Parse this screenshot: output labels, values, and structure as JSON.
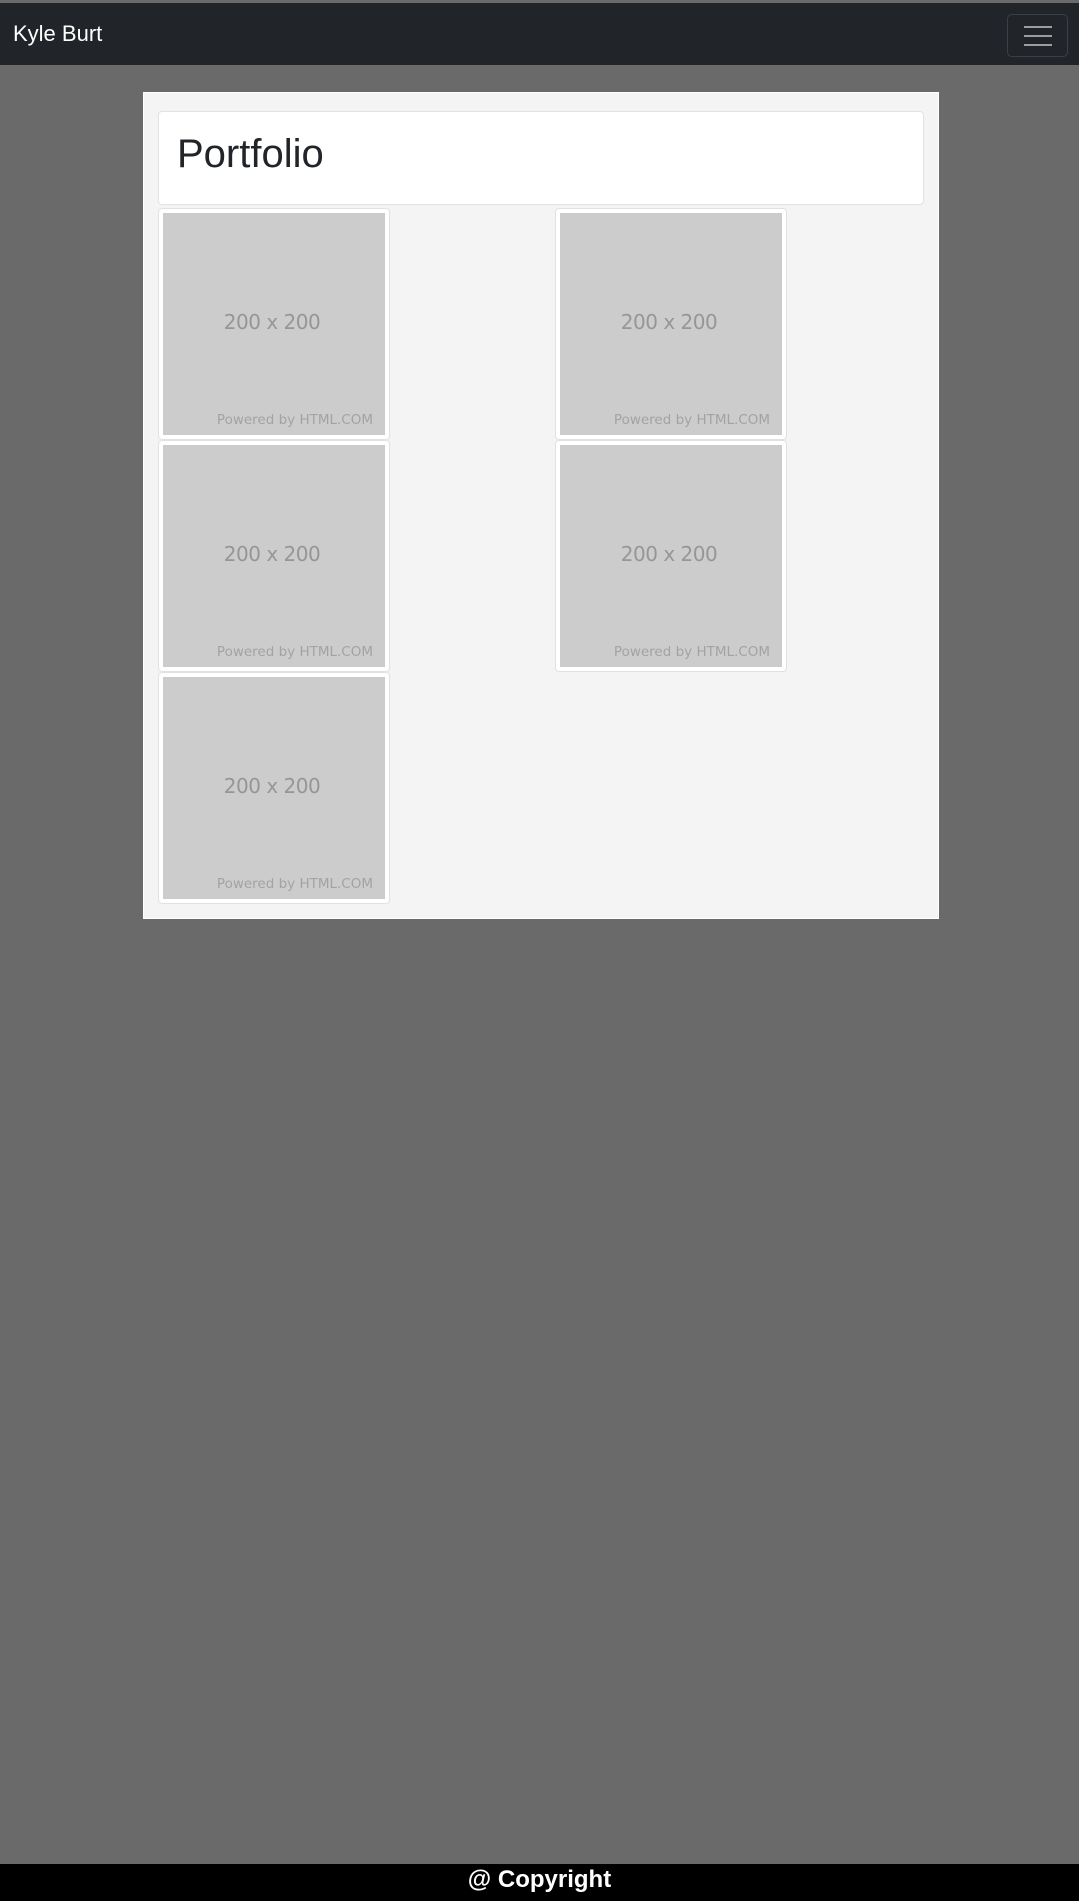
{
  "navbar": {
    "brand": "Kyle Burt",
    "toggler_icon": "hamburger-menu-icon"
  },
  "main": {
    "title": "Portfolio",
    "thumbnails": [
      {
        "size_label": "200 x 200",
        "credit": "Powered by HTML.COM"
      },
      {
        "size_label": "200 x 200",
        "credit": "Powered by HTML.COM"
      },
      {
        "size_label": "200 x 200",
        "credit": "Powered by HTML.COM"
      },
      {
        "size_label": "200 x 200",
        "credit": "Powered by HTML.COM"
      },
      {
        "size_label": "200 x 200",
        "credit": "Powered by HTML.COM"
      }
    ]
  },
  "footer": {
    "text": "@ Copyright"
  },
  "colors": {
    "navbar_bg": "#212529",
    "page_bg": "#6a6a6a",
    "container_bg": "#f4f4f4",
    "placeholder_bg": "#cccccc",
    "footer_bg": "#000000"
  }
}
